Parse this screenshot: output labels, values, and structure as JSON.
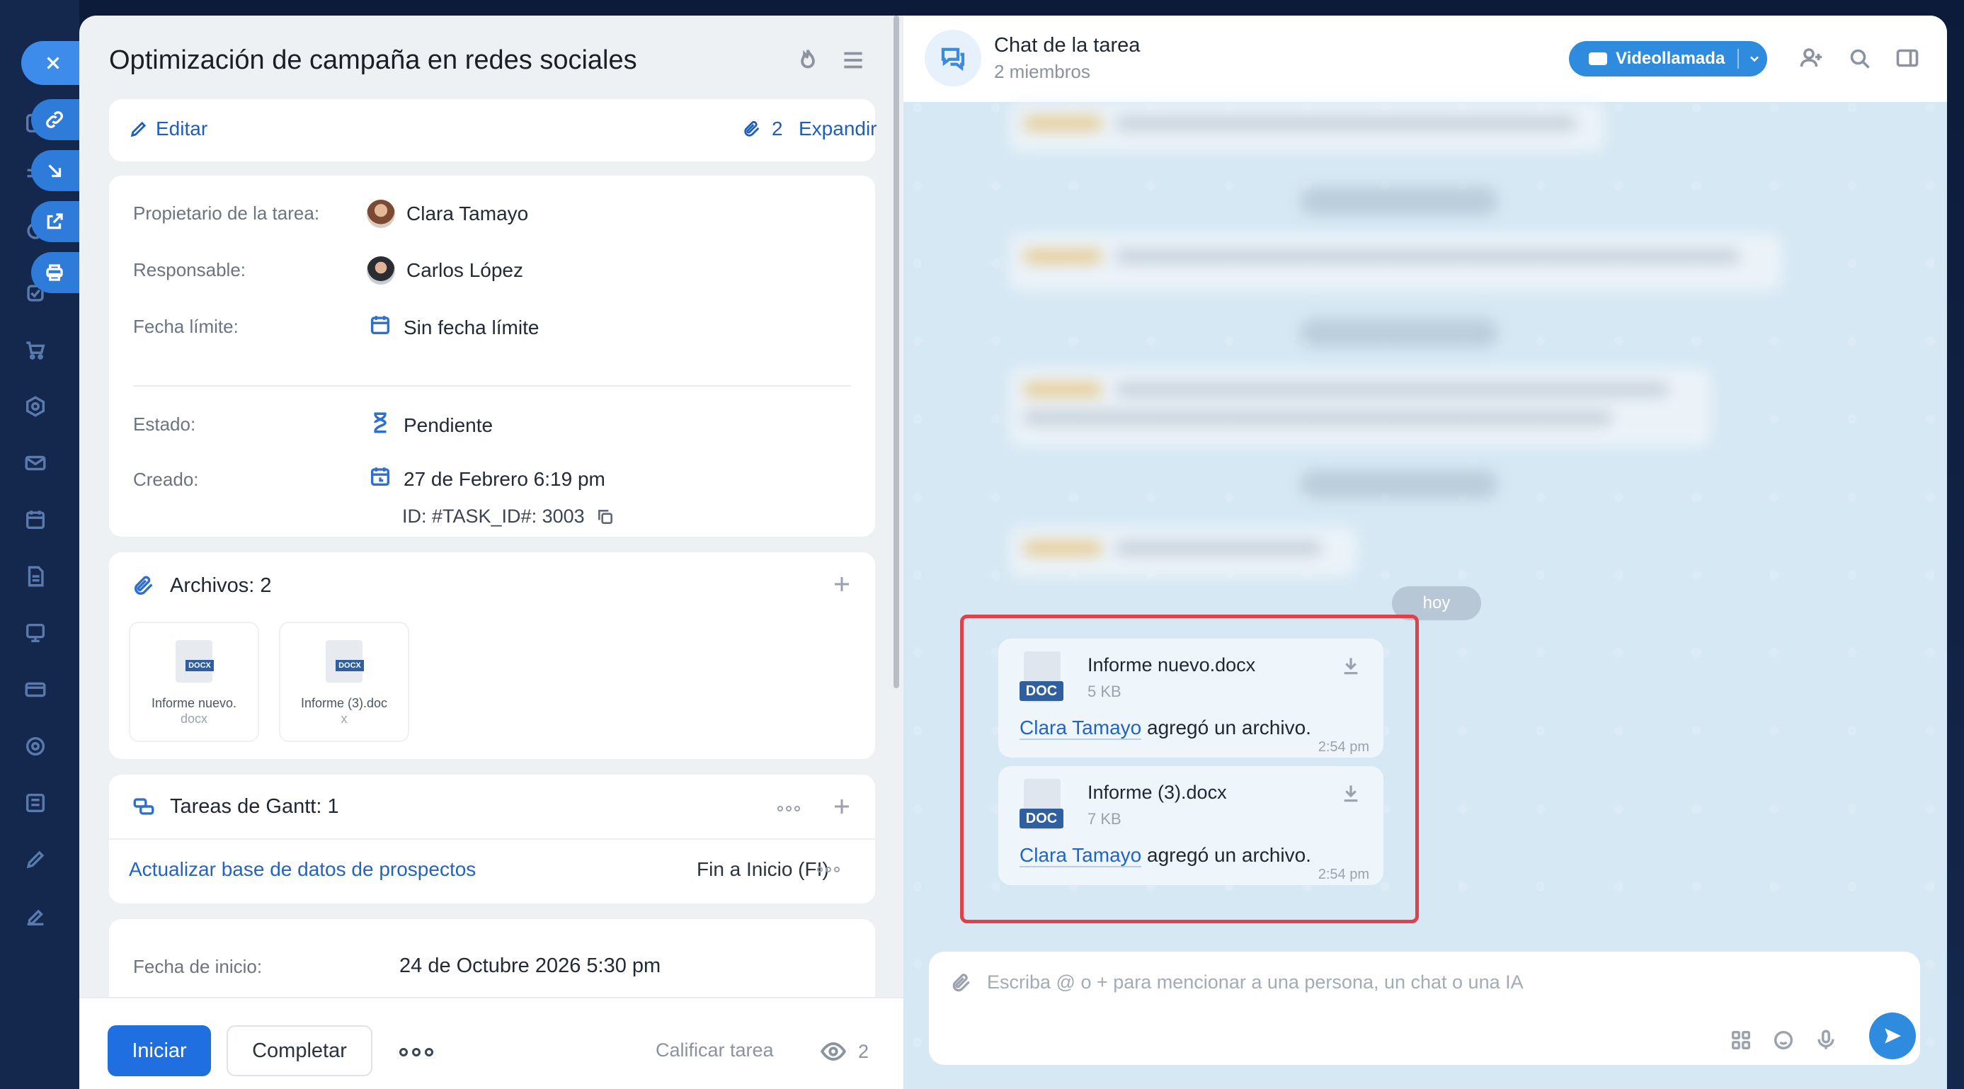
{
  "task": {
    "title": "Optimización de campaña en redes sociales",
    "edit_label": "Editar",
    "attach_count": "2",
    "expand_label": "Expandir",
    "fields": {
      "owner_label": "Propietario de la tarea:",
      "owner_value": "Clara Tamayo",
      "assignee_label": "Responsable:",
      "assignee_value": "Carlos López",
      "deadline_label": "Fecha límite:",
      "deadline_value": "Sin fecha límite",
      "status_label": "Estado:",
      "status_value": "Pendiente",
      "created_label": "Creado:",
      "created_value": "27 de Febrero 6:19 pm",
      "id_value": "ID: #TASK_ID#: 3003"
    },
    "files": {
      "title": "Archivos: 2",
      "items": [
        {
          "name_line1": "Informe nuevo.",
          "name_line2": "docx",
          "tag": "DOCX"
        },
        {
          "name_line1": "Informe (3).doc",
          "name_line2": "x",
          "tag": "DOCX"
        }
      ]
    },
    "gantt": {
      "title": "Tareas de Gantt: 1",
      "link": "Actualizar base de datos de prospectos",
      "type": "Fin a Inicio (FI)"
    },
    "dates": {
      "start_label": "Fecha de inicio:",
      "start_value": "24 de Octubre 2026 5:30 pm"
    },
    "footer": {
      "start_label": "Iniciar",
      "complete_label": "Completar",
      "rate_label": "Calificar tarea",
      "viewers": "2"
    }
  },
  "chat": {
    "title": "Chat de la tarea",
    "members": "2 miembros",
    "video_label": "Videollamada",
    "day_label": "hoy",
    "messages": [
      {
        "file": "Informe nuevo.docx",
        "size": "5 KB",
        "tag": "DOC",
        "author": "Clara Tamayo",
        "text": " agregó un archivo.",
        "time": "2:54 pm"
      },
      {
        "file": "Informe (3).docx",
        "size": "7 KB",
        "tag": "DOC",
        "author": "Clara Tamayo",
        "text": " agregó un archivo.",
        "time": "2:54 pm"
      }
    ],
    "composer_placeholder": "Escriba @ o + para mencionar a una persona, un chat o una IA"
  },
  "colors": {
    "accent": "#1f6fe0",
    "highlight": "#e0404a",
    "chat_bg": "#d6e8f4"
  }
}
